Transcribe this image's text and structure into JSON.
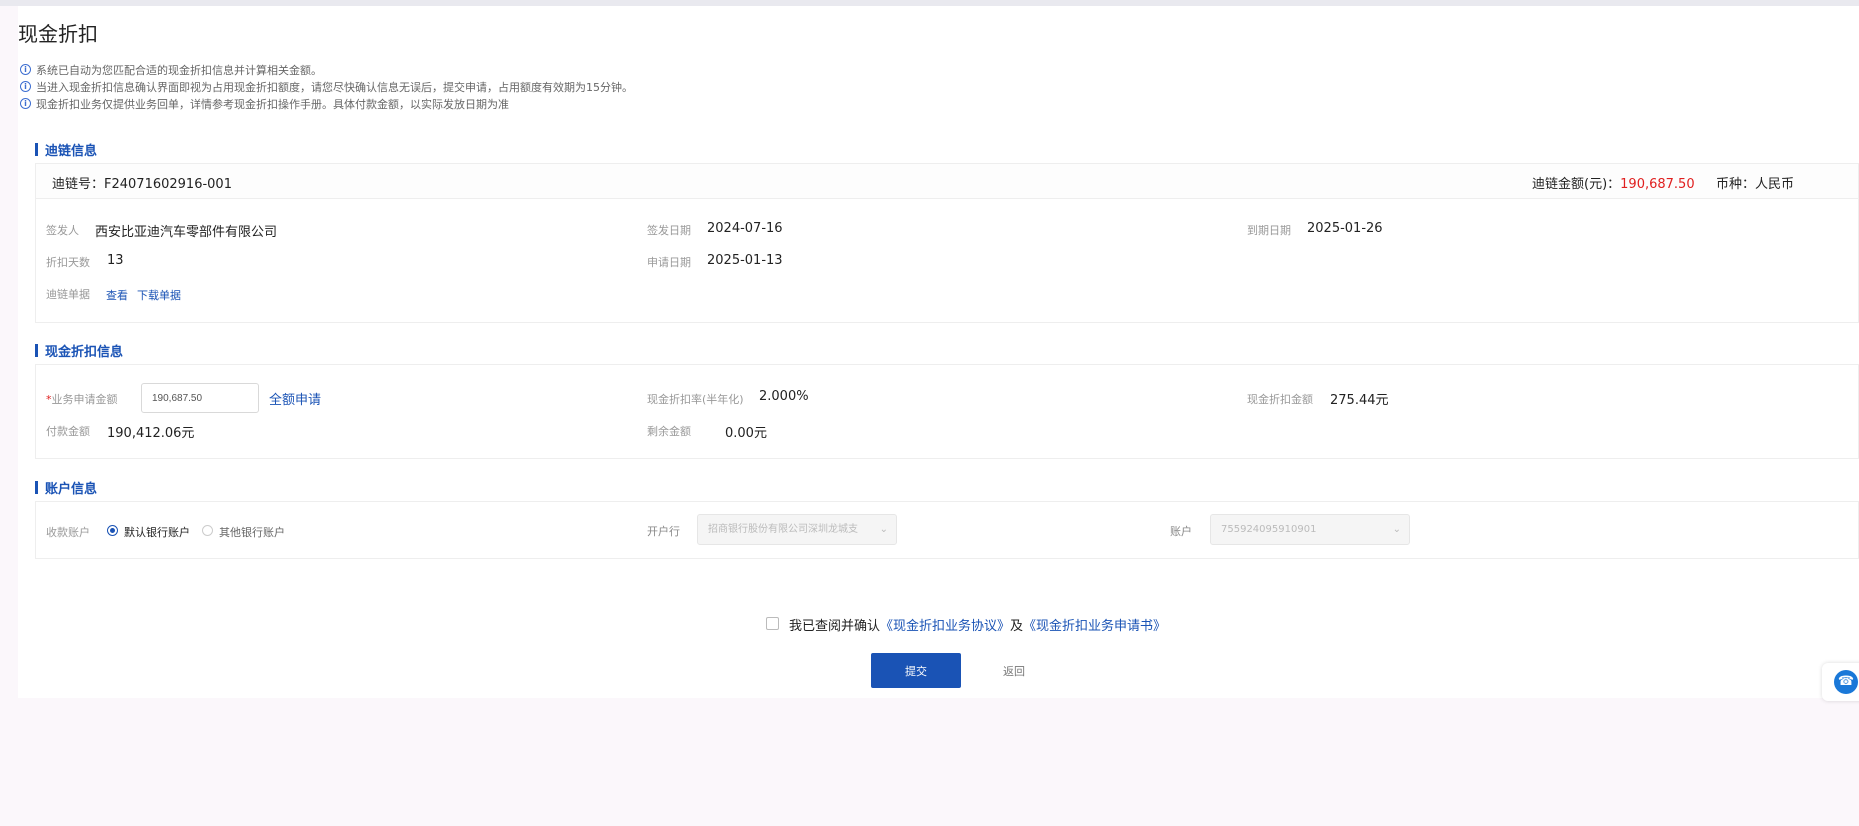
{
  "page": {
    "title": "现金折扣"
  },
  "tips": [
    "系统已自动为您匹配合适的现金折扣信息并计算相关金额。",
    "当进入现金折扣信息确认界面即视为占用现金折扣额度，请您尽快确认信息无误后，提交申请，占用额度有效期为15分钟。",
    "现金折扣业务仅提供业务回单，详情参考现金折扣操作手册。具体付款金额，以实际发放日期为准"
  ],
  "chain_section": {
    "title": "迪链信息",
    "chain_no_label": "迪链号：",
    "chain_no": "F24071602916-001",
    "amount_label": "迪链金额(元)：",
    "amount": "190,687.50",
    "currency_label": "币种：",
    "currency": "人民币",
    "issuer_label": "签发人",
    "issuer": "西安比亚迪汽车零部件有限公司",
    "issue_date_label": "签发日期",
    "issue_date": "2024-07-16",
    "due_date_label": "到期日期",
    "due_date": "2025-01-26",
    "discount_days_label": "折扣天数",
    "discount_days": "13",
    "apply_date_label": "申请日期",
    "apply_date": "2025-01-13",
    "document_label": "迪链单据",
    "view_link": "查看",
    "download_link": "下载单据"
  },
  "discount_section": {
    "title": "现金折扣信息",
    "required_mark": "*",
    "apply_amount_label": "业务申请金额",
    "apply_amount_value": "190,687.50",
    "full_apply_link": "全额申请",
    "rate_label": "现金折扣率(半年化)",
    "rate": "2.000%",
    "discount_amount_label": "现金折扣金额",
    "discount_amount": "275.44元",
    "pay_amount_label": "付款金额",
    "pay_amount": "190,412.06元",
    "remaining_label": "剩余金额",
    "remaining": "0.00元"
  },
  "account_section": {
    "title": "账户信息",
    "receive_label": "收款账户",
    "option_default": "默认银行账户",
    "option_other": "其他银行账户",
    "bank_label": "开户行",
    "bank_value": "招商银行股份有限公司深圳龙城支",
    "account_label": "账户",
    "account_value": "755924095910901"
  },
  "footer": {
    "agree_prefix": "我已查阅并确认",
    "agreement_link": "《现金折扣业务协议》",
    "and_text": "及",
    "application_link": "《现金折扣业务申请书》",
    "submit": "提交",
    "back": "返回"
  },
  "colors": {
    "accent": "#1a53b5",
    "amount_red": "#e02020"
  },
  "icons": {
    "tip": "info-icon",
    "float": "headset-icon",
    "select": "chevron-down-icon"
  }
}
